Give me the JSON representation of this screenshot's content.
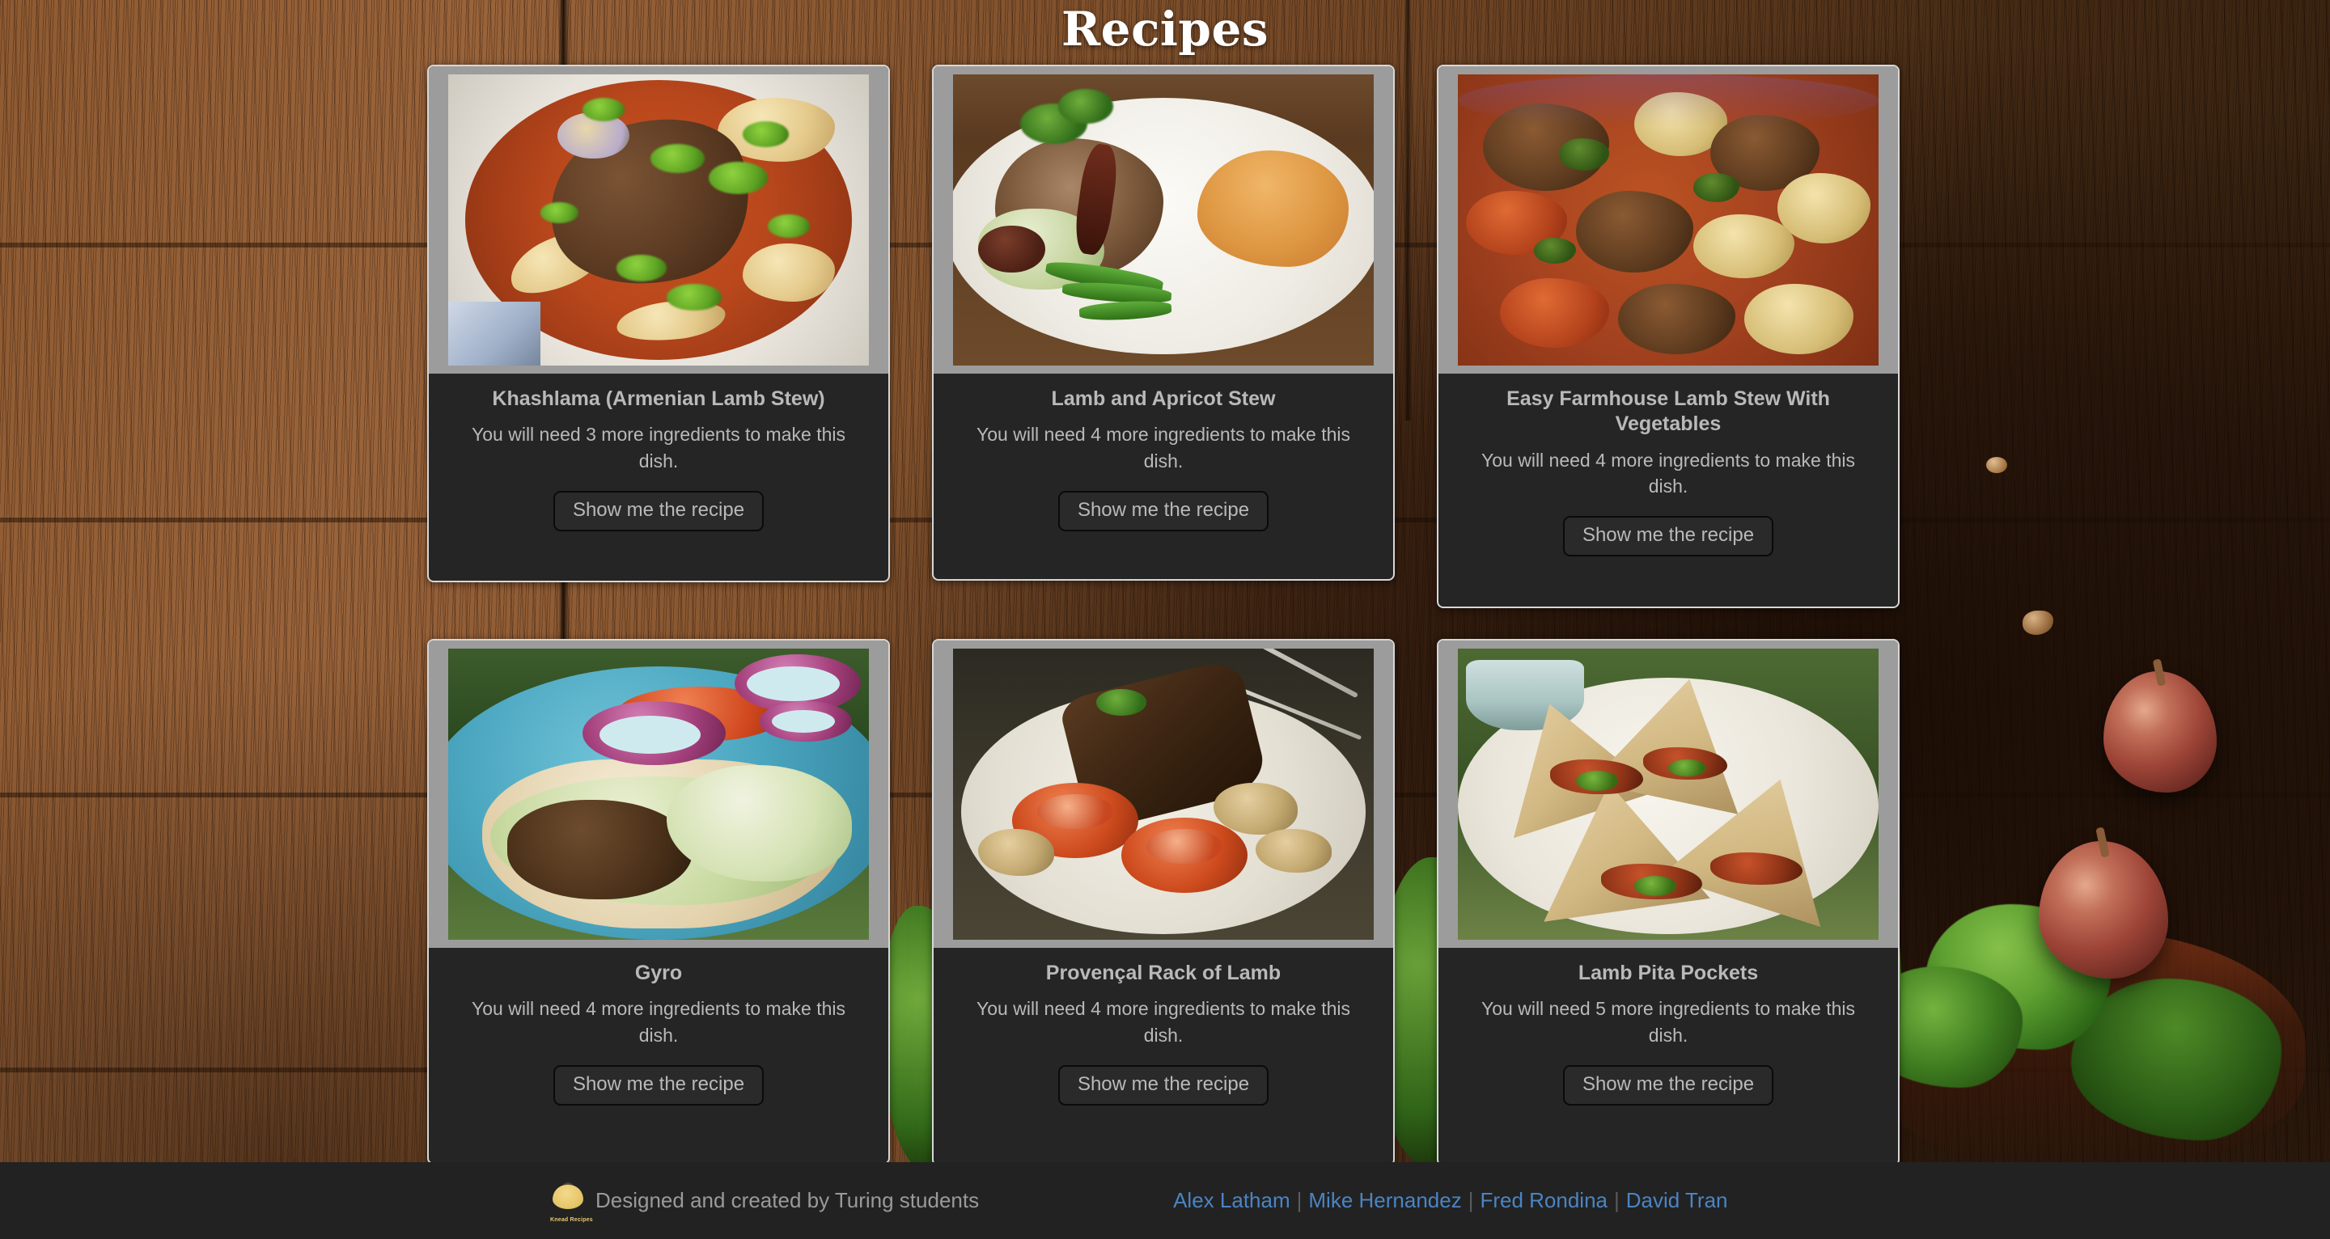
{
  "page": {
    "title": "Recipes",
    "background": "wood-table-photo",
    "accent_link_color": "#4b84c4",
    "card_background": "#252525",
    "card_text_color": "#b9b9b9"
  },
  "cards": [
    {
      "title": "Khashlama (Armenian Lamb Stew)",
      "description": "You will need 3 more ingredients to make this dish.",
      "button_label": "Show me the recipe",
      "image_alt": "lamb-stew-bowl-photo",
      "missing_ingredients": 3
    },
    {
      "title": "Lamb and Apricot Stew",
      "description": "You will need 4 more ingredients to make this dish.",
      "button_label": "Show me the recipe",
      "image_alt": "lamb-apricot-plate-photo",
      "missing_ingredients": 4
    },
    {
      "title": "Easy Farmhouse Lamb Stew With Vegetables",
      "description": "You will need 4 more ingredients to make this dish.",
      "button_label": "Show me the recipe",
      "image_alt": "farmhouse-lamb-stew-photo",
      "missing_ingredients": 4
    },
    {
      "title": "Gyro",
      "description": "You will need 4 more ingredients to make this dish.",
      "button_label": "Show me the recipe",
      "image_alt": "gyro-sandwich-photo",
      "missing_ingredients": 4
    },
    {
      "title": "Provençal Rack of Lamb",
      "description": "You will need 4 more ingredients to make this dish.",
      "button_label": "Show me the recipe",
      "image_alt": "provencal-rack-of-lamb-photo",
      "missing_ingredients": 4
    },
    {
      "title": "Lamb Pita Pockets",
      "description": "You will need 5 more ingredients to make this dish.",
      "button_label": "Show me the recipe",
      "image_alt": "lamb-pita-pockets-photo",
      "missing_ingredients": 5
    }
  ],
  "footer": {
    "logo_name": "knead-recipes-logo",
    "logo_text": "Knead Recipes",
    "credit": "Designed and created by Turing students",
    "links": [
      {
        "label": "Alex Latham"
      },
      {
        "label": "Mike Hernandez"
      },
      {
        "label": "Fred Rondina"
      },
      {
        "label": "David Tran"
      }
    ],
    "separator": "|"
  }
}
